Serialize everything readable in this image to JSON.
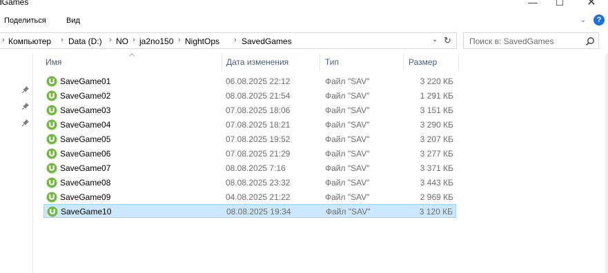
{
  "window": {
    "title": "dGames",
    "minimize_glyph": "—",
    "maximize_glyph": "☐",
    "close_glyph": "✕"
  },
  "ribbon": {
    "tabs": [
      "Поделиться",
      "Вид"
    ],
    "expand_glyph": "⌄",
    "help_glyph": "?"
  },
  "address": {
    "crumbs": [
      "Компьютер",
      "Data (D:)",
      "NO",
      "ja2no150",
      "NightOps",
      "SavedGames"
    ],
    "separator": "›",
    "dropdown_glyph": "⌄",
    "refresh_glyph": "↻"
  },
  "search": {
    "placeholder": "Поиск в: SavedGames"
  },
  "columns": {
    "name": "Имя",
    "date": "Дата изменения",
    "type": "Тип",
    "size": "Размер"
  },
  "files": [
    {
      "name": "SaveGame01",
      "date": "06.08.2025 22:12",
      "type": "Файл \"SAV\"",
      "size": "3 220 КБ",
      "selected": false
    },
    {
      "name": "SaveGame02",
      "date": "08.08.2025 21:54",
      "type": "Файл \"SAV\"",
      "size": "1 291 КБ",
      "selected": false
    },
    {
      "name": "SaveGame03",
      "date": "07.08.2025 18:06",
      "type": "Файл \"SAV\"",
      "size": "3 151 КБ",
      "selected": false
    },
    {
      "name": "SaveGame04",
      "date": "07.08.2025 18:21",
      "type": "Файл \"SAV\"",
      "size": "3 290 КБ",
      "selected": false
    },
    {
      "name": "SaveGame05",
      "date": "07.08.2025 19:52",
      "type": "Файл \"SAV\"",
      "size": "3 207 КБ",
      "selected": false
    },
    {
      "name": "SaveGame06",
      "date": "07.08.2025 21:29",
      "type": "Файл \"SAV\"",
      "size": "3 277 КБ",
      "selected": false
    },
    {
      "name": "SaveGame07",
      "date": "08.08.2025 7:16",
      "type": "Файл \"SAV\"",
      "size": "3 371 КБ",
      "selected": false
    },
    {
      "name": "SaveGame08",
      "date": "08.08.2025 23:32",
      "type": "Файл \"SAV\"",
      "size": "3 443 КБ",
      "selected": false
    },
    {
      "name": "SaveGame09",
      "date": "04.08.2025 21:22",
      "type": "Файл \"SAV\"",
      "size": "2 969 КБ",
      "selected": false
    },
    {
      "name": "SaveGame10",
      "date": "08.08.2025 19:34",
      "type": "Файл \"SAV\"",
      "size": "3 120 КБ",
      "selected": true
    }
  ],
  "icons": {
    "file": "utorrent-icon",
    "pin": "pin-icon",
    "search": "search-icon"
  },
  "colors": {
    "selection_bg": "#cce8ff",
    "selection_border": "#99d1ff",
    "file_icon": "#74b843",
    "help": "#1e6fd8",
    "header_text": "#4c607a"
  }
}
